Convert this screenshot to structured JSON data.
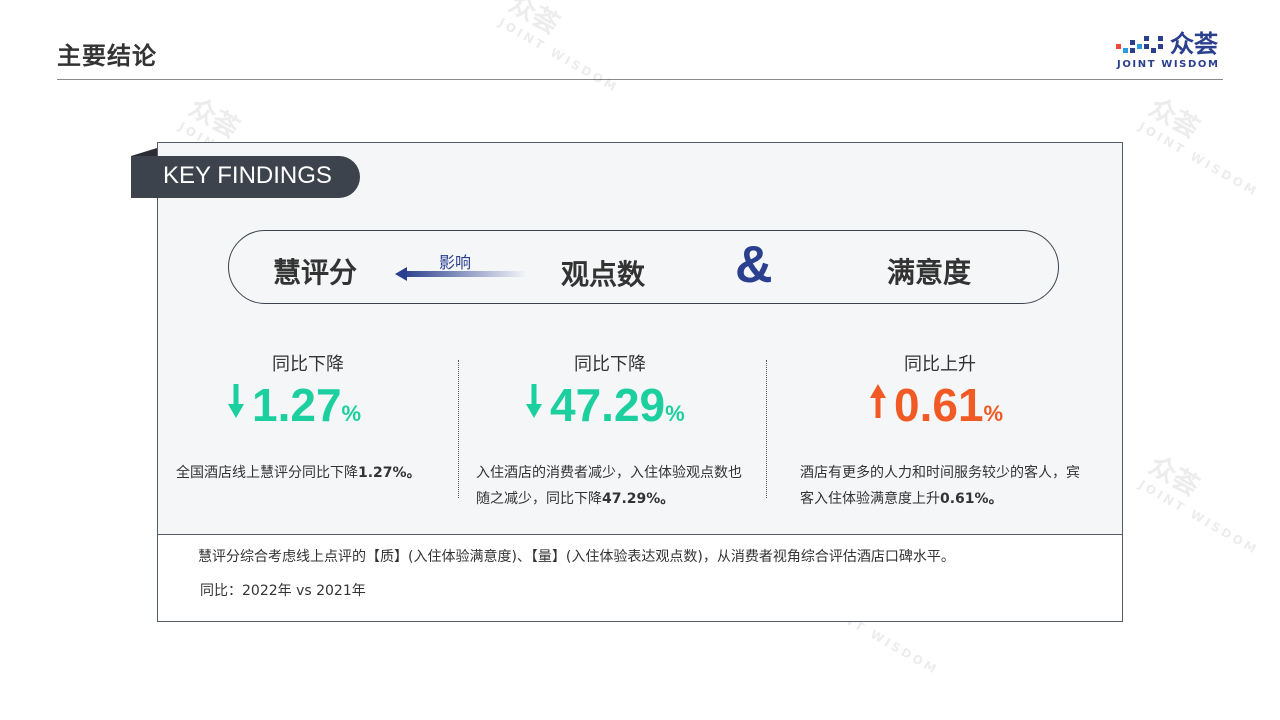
{
  "header": {
    "title": "主要结论",
    "logo_cn": "众荟",
    "logo_en": "JOINT WISDOM"
  },
  "watermark": {
    "cn": "众荟",
    "en": "JOINT WISDOM"
  },
  "key_findings": {
    "tab_label": "KEY FINDINGS",
    "term_score": "慧评分",
    "influence_label": "影响",
    "term_opinions": "观点数",
    "ampersand": "&",
    "term_satisfaction": "满意度"
  },
  "metrics": [
    {
      "trend_label": "同比下降",
      "direction": "down",
      "value": "1.27",
      "unit": "%",
      "color": "#1ccf9e",
      "desc_text": "全国酒店线上慧评分同比下降",
      "desc_bold": "1.27%。"
    },
    {
      "trend_label": "同比下降",
      "direction": "down",
      "value": "47.29",
      "unit": "%",
      "color": "#1ccf9e",
      "desc_text": "入住酒店的消费者减少，入住体验观点数也随之减少，同比下降",
      "desc_bold": "47.29%。"
    },
    {
      "trend_label": "同比上升",
      "direction": "up",
      "value": "0.61",
      "unit": "%",
      "color": "#f15a24",
      "desc_text": "酒店有更多的人力和时间服务较少的客人，宾客入住体验满意度上升",
      "desc_bold": "0.61%。"
    }
  ],
  "notes": {
    "definition": "慧评分综合考虑线上点评的【质】(入住体验满意度)、【量】(入住体验表达观点数)，从消费者视角综合评估酒店口碑水平。",
    "comparison": "同比：2022年 vs 2021年"
  },
  "colors": {
    "brand_blue": "#2b3f8f",
    "decline_green": "#1ccf9e",
    "rise_orange": "#f15a24",
    "tab_dark": "#3d434c"
  }
}
